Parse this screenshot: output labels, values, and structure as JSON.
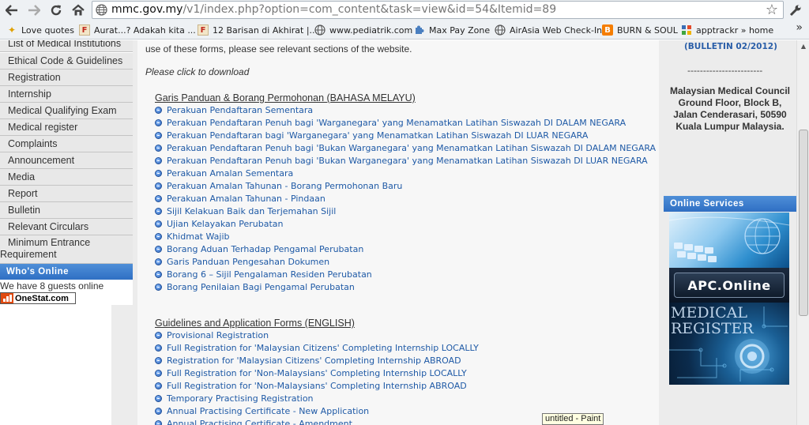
{
  "browser": {
    "url_host": "mmc.gov.my",
    "url_path": "/v1/index.php?option=com_content&task=view&id=54&Itemid=89",
    "icons": {
      "back": "back-arrow-icon",
      "forward": "forward-arrow-icon",
      "reload": "reload-icon",
      "home": "home-icon",
      "bookmark_star": "star-icon",
      "settings": "wrench-icon"
    },
    "bookmarks": [
      {
        "label": "Love quotes",
        "icon": "bookmark-star-icon"
      },
      {
        "label": "Aurat...? Adakah kita ...",
        "icon": "f-logo-icon"
      },
      {
        "label": "12 Barisan di Akhirat |...",
        "icon": "f-logo-icon"
      },
      {
        "label": "www.pediatrik.com",
        "icon": "globe-icon"
      },
      {
        "label": "Max Pay Zone",
        "icon": "puzzle-icon"
      },
      {
        "label": "AirAsia Web Check-In",
        "icon": "globe-icon"
      },
      {
        "label": "BURN & SOUL",
        "icon": "blogger-icon"
      },
      {
        "label": "apptrackr » home",
        "icon": "grid-icon"
      }
    ],
    "bookmarks_more": "»"
  },
  "left_nav": {
    "items": [
      "List of Medical Institutions",
      "Ethical Code & Guidelines",
      "Registration",
      "Internship",
      "Medical Qualifying Exam",
      "Medical register",
      "Complaints",
      "Announcement",
      "Media",
      "Report",
      "Bulletin",
      "Relevant Circulars"
    ],
    "min_entrance_line1": "Minimum Entrance",
    "min_entrance_line2": "Requirement",
    "whos_online_title": "Who's Online",
    "guests_text": "We have 8 guests online",
    "onestat_label": "OneStat.com"
  },
  "content": {
    "intro_text": "use of these forms, please see relevant sections of the website.",
    "click_text": "Please click to download",
    "malay_section": {
      "title": "Garis Panduan & Borang Permohonan (BAHASA MELAYU)",
      "links": [
        "Perakuan Pendaftaran Sementara",
        "Perakuan Pendaftaran Penuh bagi 'Warganegara' yang Menamatkan Latihan Siswazah DI DALAM NEGARA",
        "Perakuan Pendaftaran bagi 'Warganegara' yang Menamatkan Latihan Siswazah DI LUAR NEGARA",
        "Perakuan Pendaftaran Penuh bagi 'Bukan Warganegara' yang Menamatkan Latihan Siswazah DI DALAM NEGARA",
        "Perakuan Pendaftaran Penuh bagi 'Bukan Warganegara' yang Menamatkan Latihan Siswazah DI LUAR NEGARA",
        "Perakuan Amalan Sementara",
        "Perakuan Amalan Tahunan - Borang Permohonan Baru",
        "Perakuan Amalan Tahunan - Pindaan",
        "Sijil Kelakuan Baik dan Terjemahan Sijil",
        "Ujian Kelayakan Perubatan",
        "Khidmat Wajib",
        "Borang Aduan Terhadap Pengamal Perubatan",
        "Garis Panduan Pengesahan Dokumen",
        "Borang 6 – Sijil Pengalaman Residen Perubatan",
        "Borang Penilaian Bagi Pengamal Perubatan"
      ]
    },
    "english_section": {
      "title": "Guidelines and Application Forms (ENGLISH)",
      "links": [
        "Provisional Registration",
        "Full Registration for 'Malaysian Citizens' Completing Internship LOCALLY",
        "Registration for 'Malaysian Citizens' Completing Internship ABROAD",
        "Full Registration for 'Non-Malaysians' Completing Internship LOCALLY",
        "Full Registration for 'Non-Malaysians' Completing Internship ABROAD",
        "Temporary Practising Registration",
        "Annual Practising Certificate - New Application",
        "Annual Practising Certificate - Amendment"
      ]
    }
  },
  "right_col": {
    "bulletin_link": "(BULLETIN 02/2012)",
    "dashes": "------------------------",
    "address_lines": [
      "Malaysian Medical Council",
      "Ground Floor, Block B,",
      "Jalan Cenderasari, 50590",
      "Kuala Lumpur Malaysia."
    ],
    "online_services_title": "Online Services",
    "apc_label": "APC.Online",
    "medical_register_line1": "MEDICAL",
    "medical_register_line2": "REGISTER"
  },
  "tooltip": "untitled - Paint",
  "colors": {
    "link": "#1f5aa6",
    "header_blue": "#3a7bcc",
    "nav_bg": "#e8e8e8"
  }
}
